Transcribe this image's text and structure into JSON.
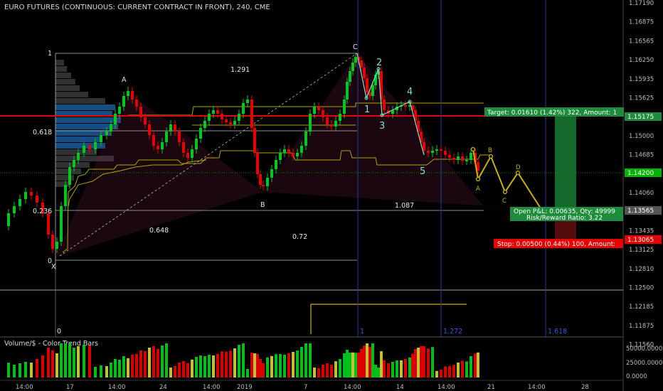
{
  "header": {
    "title": "EURO FUTURES (CONTINUOUS: CURRENT CONTRACT IN FRONT), 240, CME"
  },
  "volume_pane": {
    "title": "Volume/$ - Color Trend Bars",
    "axis_labels": [
      "50000.0000",
      "25000.0000",
      "0.0000"
    ]
  },
  "price_axis": {
    "labels": [
      "1.17190",
      "1.16875",
      "1.16565",
      "1.16250",
      "1.15935",
      "1.15625",
      "1.15310",
      "1.15000",
      "1.14685",
      "1.14375",
      "1.14060",
      "1.13750",
      "1.13435",
      "1.13125",
      "1.12810",
      "1.12500",
      "1.12185",
      "1.11875",
      "1.11560"
    ],
    "tags": {
      "target": "1.15175",
      "current": "1.14200",
      "entry": "1.13565",
      "stop": "1.13065"
    }
  },
  "time_axis": {
    "labels": [
      "14:00",
      "17",
      "14:00",
      "24",
      "14:00",
      "2019",
      "7",
      "14:00",
      "14",
      "14:00",
      "21",
      "14:00",
      "28"
    ]
  },
  "position": {
    "target_label": "Target: 0.01610 (1.42%) 322, Amount: 1",
    "open_label": "Open P&L: 0.00635, Qty: 49999",
    "ratio_label": "Risk/Reward Ratio: 3.22",
    "stop_label": "Stop: 0.00500 (0.44%) 100, Amount:"
  },
  "pattern_labels": {
    "x": "X",
    "a": "A",
    "b": "B",
    "c": "C",
    "harmonic_a2": "A",
    "projection_b": "B",
    "projection_c": "C",
    "projection_d": "D"
  },
  "wave_labels": [
    "1",
    "2",
    "3",
    "4",
    "5"
  ],
  "fib_labels": {
    "f1_top": "1",
    "f1291": "1.291",
    "f0618": "0.618",
    "f0236": "0.236",
    "f0648": "0.648",
    "f072": "0.72",
    "f1087": "1.087",
    "f0_left": "0",
    "f0_bottom": "0"
  },
  "time_fib_labels": [
    "1",
    "1.272",
    "1.618"
  ],
  "colors": {
    "up": "#00c81e",
    "down": "#e60000",
    "neutral": "#cccc33",
    "target": "#1e8c3c",
    "stop": "#c81414",
    "current": "#00b400",
    "elliott": "#7fe0d0",
    "harmonic": "#c8b400"
  }
}
